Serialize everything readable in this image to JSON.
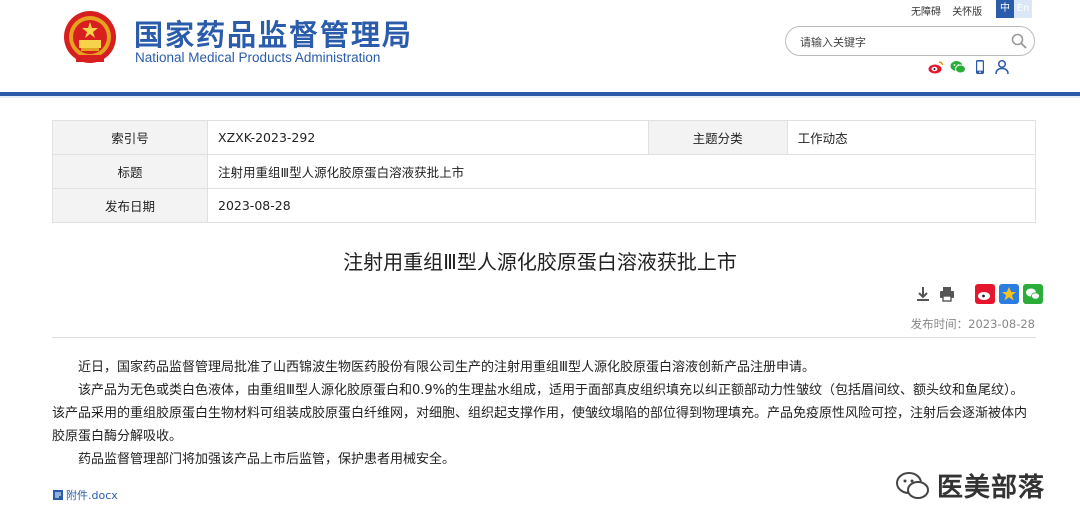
{
  "header": {
    "title": "国家药品监督管理局",
    "subtitle": "National Medical Products Administration",
    "top_links": [
      "无障碍",
      "关怀版"
    ],
    "lang_zh": "中",
    "lang_en": "En",
    "search_placeholder": "请输入关键字"
  },
  "meta": {
    "index_label": "索引号",
    "index_value": "XZXK-2023-292",
    "category_label": "主题分类",
    "category_value": "工作动态",
    "title_label": "标题",
    "title_value": "注射用重组Ⅲ型人源化胶原蛋白溶液获批上市",
    "date_label": "发布日期",
    "date_value": "2023-08-28"
  },
  "article": {
    "title": "注射用重组Ⅲ型人源化胶原蛋白溶液获批上市",
    "pubdate": "发布时间：2023-08-28",
    "paragraphs": [
      "近日，国家药品监督管理局批准了山西锦波生物医药股份有限公司生产的注射用重组Ⅲ型人源化胶原蛋白溶液创新产品注册申请。",
      "该产品为无色或类白色液体，由重组Ⅲ型人源化胶原蛋白和0.9%的生理盐水组成，适用于面部真皮组织填充以纠正额部动力性皱纹（包括眉间纹、额头纹和鱼尾纹）。该产品采用的重组胶原蛋白生物材料可组装成胶原蛋白纤维网，对细胞、组织起支撑作用，使皱纹塌陷的部位得到物理填充。产品免疫原性风险可控，注射后会逐渐被体内胶原蛋白酶分解吸收。",
      "药品监督管理部门将加强该产品上市后监管，保护患者用械安全。"
    ],
    "attachment": "附件.docx"
  },
  "watermark": "医美部落",
  "colors": {
    "brand_blue": "#2a5cab",
    "weibo_red": "#e6162d",
    "wechat_green": "#2bad39"
  },
  "icons": [
    "national-emblem",
    "search-icon",
    "weibo-icon",
    "wechat-icon",
    "mobile-icon",
    "user-icon",
    "download-icon",
    "print-icon",
    "share-weibo-icon",
    "share-qzone-icon",
    "share-wechat-icon",
    "docx-icon"
  ]
}
